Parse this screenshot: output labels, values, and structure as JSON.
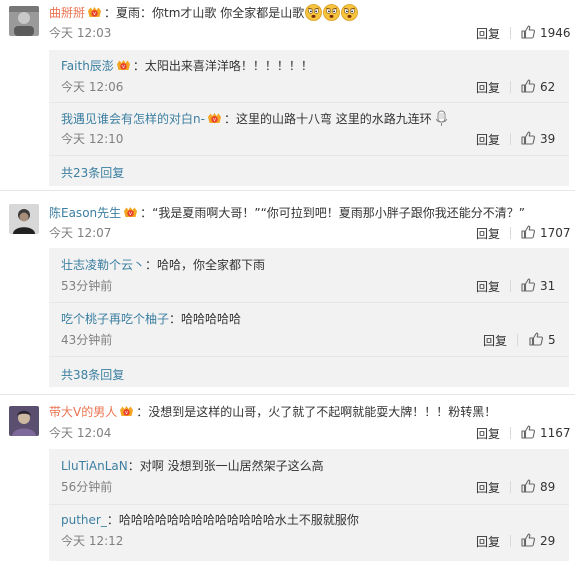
{
  "threads": [
    {
      "user": "曲掰掰",
      "text": "：夏雨：你tm才山歌 你全家都是山歌",
      "time": "今天 12:03",
      "reply_label": "回复",
      "likes": "1946",
      "emoji": "angry-face-icon",
      "replies": [
        {
          "user": "Faith辰澎",
          "text": "：太阳出来喜洋洋咯！！！！！！",
          "time": "今天 12:06",
          "reply_label": "回复",
          "likes": "62"
        },
        {
          "user": "我遇见谁会有怎样的对白n-",
          "text": "：这里的山路十八弯 这里的水路九连环",
          "time": "今天 12:10",
          "reply_label": "回复",
          "likes": "39",
          "icon": "microphone-icon"
        }
      ],
      "more": "共23条回复"
    },
    {
      "user": "陈Eason先生",
      "text": "：“我是夏雨啊大哥！”“你可拉到吧！夏雨那小胖子跟你我还能分不清？”",
      "time": "今天 12:07",
      "reply_label": "回复",
      "likes": "1707",
      "replies": [
        {
          "user": "壮志凌勒个云丶",
          "text": "：哈哈，你全家都下雨",
          "time": "53分钟前",
          "reply_label": "回复",
          "likes": "31"
        },
        {
          "user": "吃个桃子再吃个柚子",
          "text": "：哈哈哈哈哈",
          "time": "43分钟前",
          "reply_label": "回复",
          "likes": "5"
        }
      ],
      "more": "共38条回复"
    },
    {
      "user": "带大V的男人",
      "text": "：没想到是这样的山哥，火了就了不起啊就能耍大牌！！！粉转黑！",
      "time": "今天 12:04",
      "reply_label": "回复",
      "likes": "1167",
      "replies": [
        {
          "user": "LluTiAnLaN",
          "text": "：对啊 没想到张一山居然架子这么高",
          "time": "56分钟前",
          "reply_label": "回复",
          "likes": "89"
        },
        {
          "user": "puther_",
          "text": "：哈哈哈哈哈哈哈哈哈哈哈哈哈水土不服就服你",
          "time": "今天 12:12",
          "reply_label": "回复",
          "likes": "29"
        }
      ]
    }
  ],
  "colors": {
    "main_user": "#eb7350",
    "sub_user": "#3c7fa1",
    "sub_bg": "#f2f2f2",
    "meta": "#808080"
  },
  "icons": {
    "vip_badge": "vip-crown-badge-icon",
    "like": "thumbs-up-icon"
  }
}
